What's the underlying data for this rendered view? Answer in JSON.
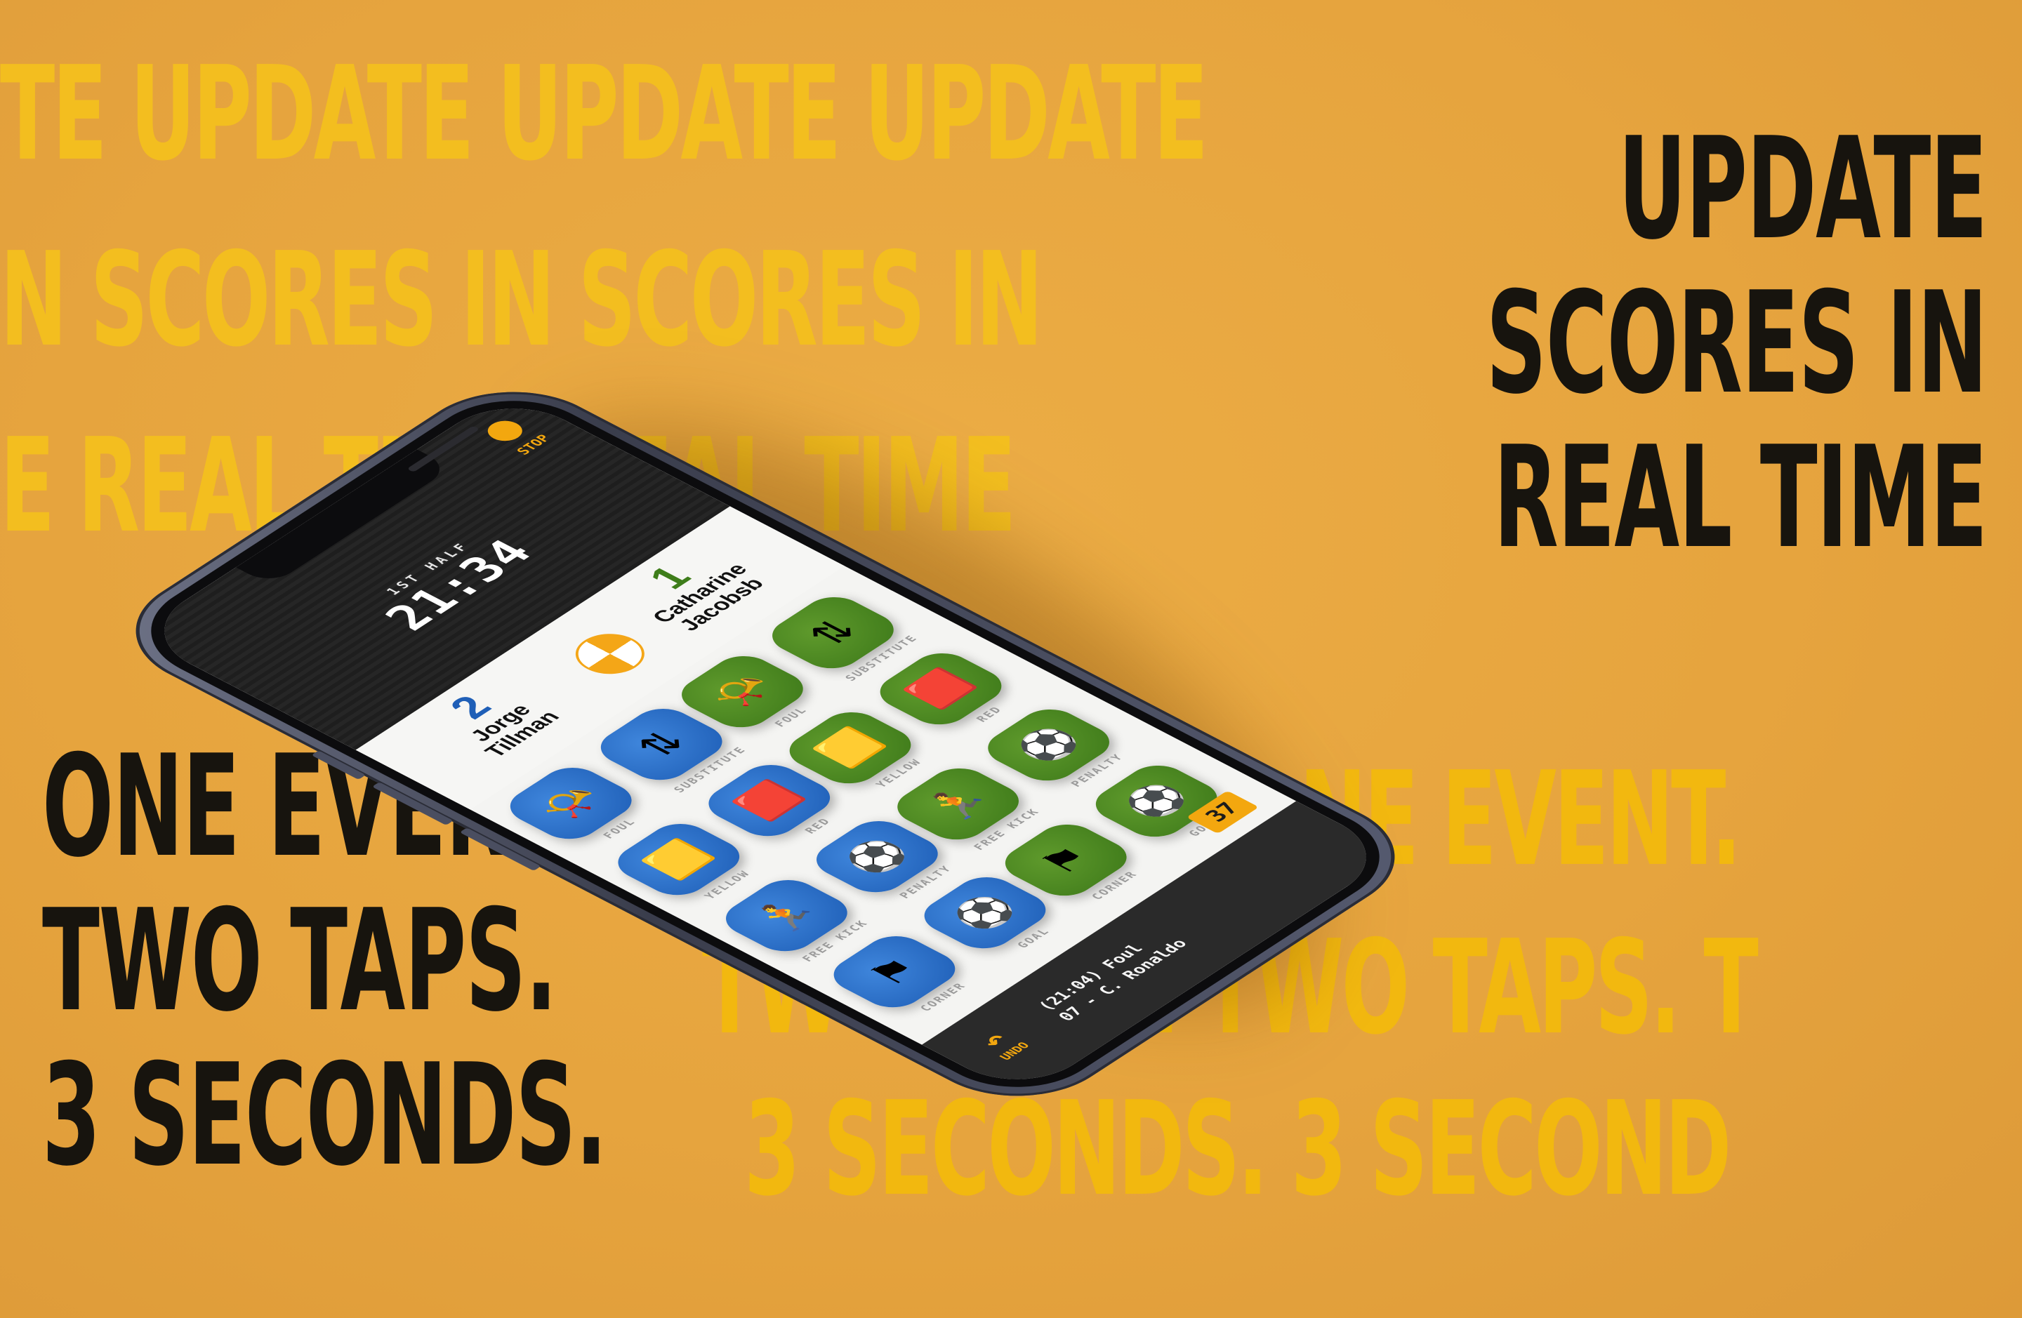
{
  "background_words": {
    "row1": "TE UPDATE UPDATE UPDATE",
    "row2": "N SCORES IN SCORES IN",
    "row3": "E REAL TIME REAL TIME",
    "row4": "ONE EVENT. ONE EVENT.",
    "row5": "TWO TAPS. TWO TAPS. T",
    "row6": "3 SECONDS. 3 SECOND"
  },
  "headline_right": [
    "UPDATE",
    "SCORES IN",
    "REAL TIME"
  ],
  "headline_left": [
    "ONE EVENT.",
    "TWO TAPS.",
    "3 SECONDS."
  ],
  "app": {
    "stop_label": "STOP",
    "half_label": "1ST HALF",
    "clock": "21:34",
    "home_team": {
      "score": "2",
      "name_line1": "Jorge",
      "name_line2": "Tillman"
    },
    "away_team": {
      "score": "1",
      "name_line1": "Catharine",
      "name_line2": "Jacobsb"
    },
    "home_buttons": [
      {
        "label": "FOUL",
        "icon": "whistle-icon",
        "glyph": "📯"
      },
      {
        "label": "SUBSTITUTE",
        "icon": "substitute-icon",
        "glyph": "⇅"
      },
      {
        "label": "YELLOW",
        "icon": "yellow-card-icon",
        "glyph": "🟨"
      },
      {
        "label": "RED",
        "icon": "red-card-icon",
        "glyph": "🟥"
      },
      {
        "label": "FREE KICK",
        "icon": "free-kick-icon",
        "glyph": "🏃"
      },
      {
        "label": "PENALTY",
        "icon": "penalty-icon",
        "glyph": "⚽"
      },
      {
        "label": "CORNER",
        "icon": "corner-flag-icon",
        "glyph": "⚑"
      },
      {
        "label": "GOAL",
        "icon": "goal-ball-icon",
        "glyph": "⚽"
      }
    ],
    "away_buttons": [
      {
        "label": "FOUL",
        "icon": "whistle-icon",
        "glyph": "📯"
      },
      {
        "label": "SUBSTITUTE",
        "icon": "substitute-icon",
        "glyph": "⇅"
      },
      {
        "label": "YELLOW",
        "icon": "yellow-card-icon",
        "glyph": "🟨"
      },
      {
        "label": "RED",
        "icon": "red-card-icon",
        "glyph": "🟥"
      },
      {
        "label": "FREE KICK",
        "icon": "free-kick-icon",
        "glyph": "🏃"
      },
      {
        "label": "PENALTY",
        "icon": "penalty-icon",
        "glyph": "⚽"
      },
      {
        "label": "CORNER",
        "icon": "corner-flag-icon",
        "glyph": "⚑"
      },
      {
        "label": "GOAL",
        "icon": "goal-ball-icon",
        "glyph": "⚽"
      }
    ],
    "counter": "37",
    "undo_label": "UNDO",
    "last_event_line1": "(21:04) Foul",
    "last_event_line2": "07 - C. Ronaldo"
  },
  "colors": {
    "background": "#e6a43e",
    "accent": "#f3a70f",
    "home_blue": "#1f5fb7",
    "away_green": "#3e7a1a",
    "headline": "#17140e"
  }
}
